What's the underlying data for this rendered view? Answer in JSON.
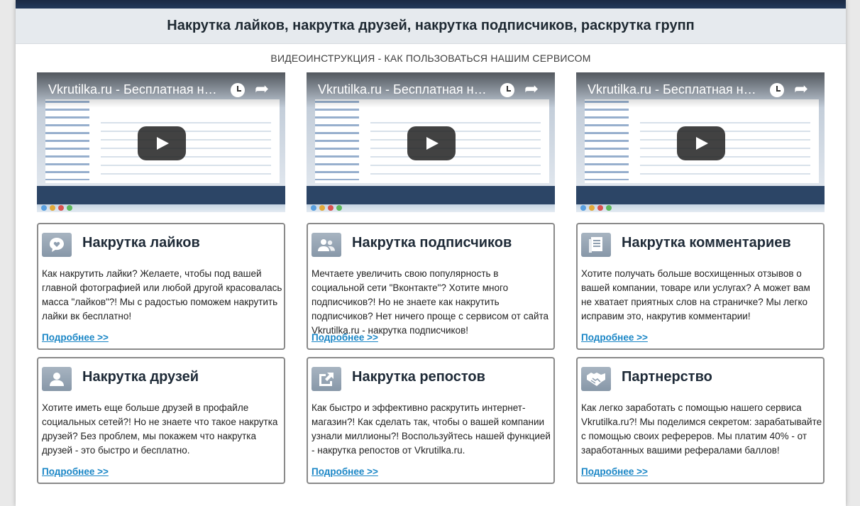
{
  "header": {
    "title": "Накрутка лайков, накрутка друзей, накрутка подписчиков, раскрутка групп"
  },
  "videos_section": {
    "title": "ВИДЕОИНСТРУКЦИЯ - КАК ПОЛЬЗОВАТЬСЯ НАШИМ СЕРВИСОМ",
    "videos": [
      {
        "title": "Vkrutilka.ru - Бесплатная на..."
      },
      {
        "title": "Vkrutilka.ru - Бесплатная на..."
      },
      {
        "title": "Vkrutilka.ru - Бесплатная на..."
      }
    ]
  },
  "services": [
    {
      "title": "Накрутка лайков",
      "icon": "heart-chat-icon",
      "text": "Как накрутить лайки? Желаете, чтобы под вашей главной фотографией или любой другой красовалась масса \"лайков\"?! Мы с радостью поможем накрутить лайки вк бесплатно!",
      "link": "Подробнее >>"
    },
    {
      "title": "Накрутка подписчиков",
      "icon": "users-icon",
      "text": "Мечтаете увеличить свою популярность в социальной сети \"Вконтакте\"? Хотите много подписчиков?! Но не знаете как накрутить подписчиков? Нет ничего проще с сервисом от сайта Vkrutilka.ru - накрутка подписчиков!",
      "link": "Подробнее >>"
    },
    {
      "title": "Накрутка комментариев",
      "icon": "document-icon",
      "text": "Хотите получать больше восхищенных отзывов о вашей компании, товаре или услугах? А может вам не хватает приятных слов на страничке? Мы легко исправим это, накрутив комментарии!",
      "link": "Подробнее >>"
    },
    {
      "title": "Накрутка друзей",
      "icon": "user-icon",
      "text": "Хотите иметь еще больше друзей в профайле социальных сетей?! Но не знаете что такое накрутка друзей? Без проблем, мы покажем что накрутка друзей - это быстро и бесплатно.",
      "link": "Подробнее >>"
    },
    {
      "title": "Накрутка репостов",
      "icon": "share-arrow-icon",
      "text": "Как быстро и эффективно раскрутить интернет-магазин?! Как сделать так, чтобы о вашей компании узнали миллионы?! Воспользуйтесь нашей функцией - накрутка репостов от Vkrutilka.ru.",
      "link": "Подробнее >>"
    },
    {
      "title": "Партнерство",
      "icon": "handshake-icon",
      "text": "Как легко заработать с помощью нашего сервиса Vkrutilka.ru?! Мы поделимся секретом: зарабатывайте с помощью своих рефереров. Мы платим 40% - от заработанных вашими рефералами баллов!",
      "link": "Подробнее >>"
    }
  ],
  "colors": {
    "link": "#1a86c6",
    "header_bar": "#e6eaee",
    "top_band": "#1b2a44"
  }
}
